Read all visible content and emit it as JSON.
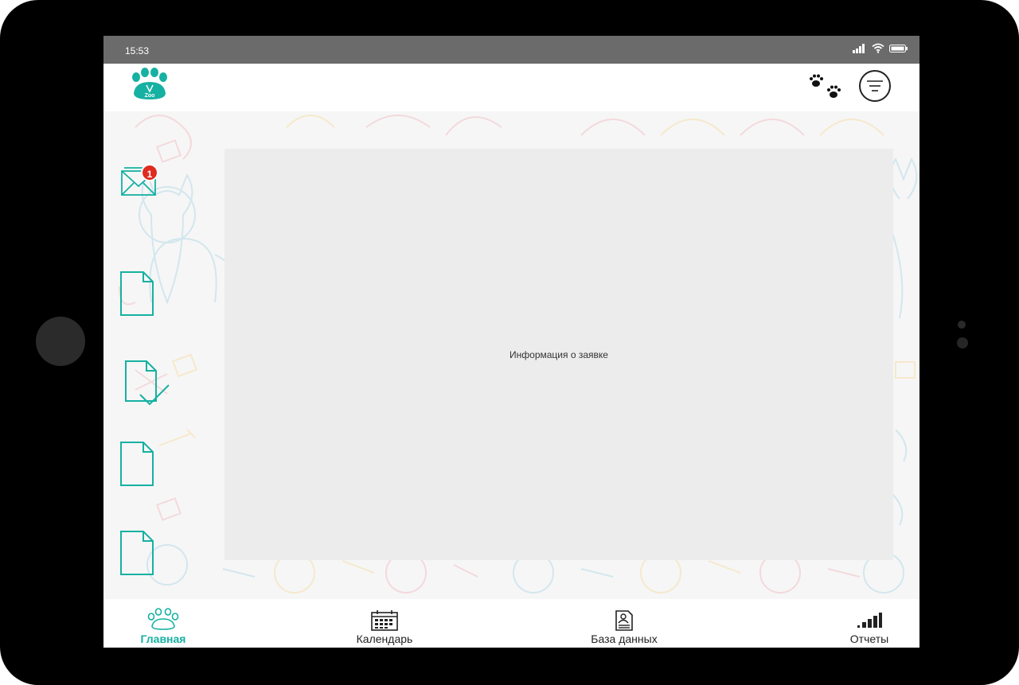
{
  "status_bar": {
    "time": "15:53"
  },
  "app": {
    "logo_text": "Zoo"
  },
  "side_menu": {
    "messages_badge": "1",
    "items": [
      "mail-icon",
      "document-icon",
      "document-check-icon",
      "document-icon",
      "document-icon"
    ]
  },
  "main": {
    "info_text": "Информация о заявке"
  },
  "tabs": [
    {
      "label": "Главная",
      "icon": "paw-icon",
      "active": true
    },
    {
      "label": "Календарь",
      "icon": "calendar-icon",
      "active": false
    },
    {
      "label": "База данных",
      "icon": "contact-card-icon",
      "active": false
    },
    {
      "label": "Отчеты",
      "icon": "signal-bars-icon",
      "active": false
    }
  ],
  "colors": {
    "accent": "#16b1a2",
    "badge": "#e02b20",
    "status_bar": "#6b6b6b",
    "panel": "#ececec"
  }
}
